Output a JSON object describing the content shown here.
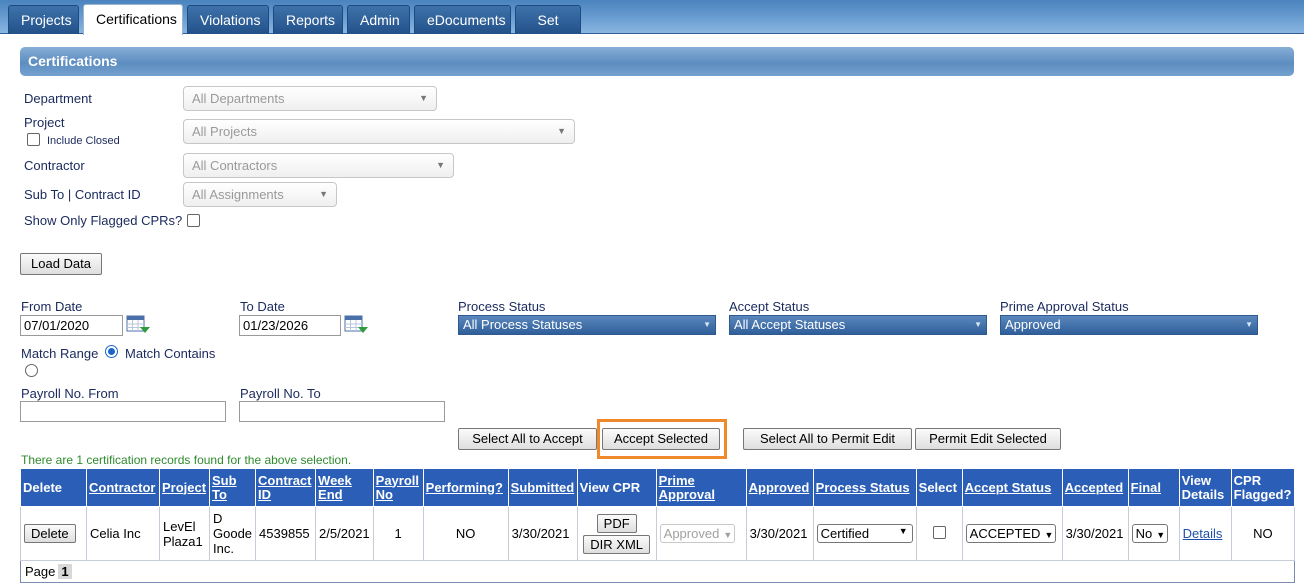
{
  "tabs": [
    "Projects",
    "Certifications",
    "Violations",
    "Reports",
    "Admin",
    "eDocuments",
    "Set Up"
  ],
  "section_title": "Certifications",
  "filters": {
    "department_label": "Department",
    "department_value": "All Departments",
    "project_label": "Project",
    "include_closed_label": "Include Closed",
    "project_value": "All Projects",
    "contractor_label": "Contractor",
    "contractor_value": "All Contractors",
    "subto_label": "Sub To | Contract ID",
    "subto_value": "All Assignments",
    "flagged_label": "Show Only Flagged CPRs?",
    "load_button": "Load Data"
  },
  "dates": {
    "from_label": "From Date",
    "from_value": "07/01/2020",
    "to_label": "To Date",
    "to_value": "01/23/2026",
    "process_status_label": "Process Status",
    "process_status_value": "All Process Statuses",
    "accept_status_label": "Accept Status",
    "accept_status_value": "All Accept Statuses",
    "prime_status_label": "Prime Approval Status",
    "prime_status_value": "Approved",
    "match_range_label": "Match Range",
    "match_contains_label": "Match Contains",
    "payroll_from_label": "Payroll No. From",
    "payroll_to_label": "Payroll No. To"
  },
  "actions": {
    "select_all_accept": "Select All to Accept",
    "accept_selected": "Accept Selected",
    "select_all_permit": "Select All to Permit Edit",
    "permit_edit_selected": "Permit Edit Selected"
  },
  "found_text": "There are 1 certification records found for the above selection.",
  "table": {
    "headers": {
      "delete": "Delete",
      "contractor": "Contractor",
      "project": "Project",
      "sub_to": "Sub To",
      "contract_id": "Contract ID",
      "week_end": "Week End",
      "payroll_no": "Payroll No",
      "performing": "Performing?",
      "submitted": "Submitted",
      "view_cpr": "View CPR",
      "prime_approval": "Prime Approval",
      "approved": "Approved",
      "process_status": "Process Status",
      "select": "Select",
      "accept_status": "Accept Status",
      "accepted": "Accepted",
      "final": "Final",
      "view_details": "View Details",
      "cpr_flagged": "CPR Flagged?"
    },
    "row": {
      "delete_button": "Delete",
      "contractor": "Celia Inc",
      "project": "LevEl Plaza1",
      "sub_to": "D Goode Inc.",
      "contract_id": "4539855",
      "week_end": "2/5/2021",
      "payroll_no": "1",
      "performing": "NO",
      "submitted": "3/30/2021",
      "pdf_button": "PDF",
      "dir_xml_button": "DIR XML",
      "prime_approval": "Approved",
      "approved": "3/30/2021",
      "process_status": "Certified",
      "accept_status": "ACCEPTED",
      "accepted": "3/30/2021",
      "final": "No",
      "details_link": "Details",
      "cpr_flagged": "NO"
    },
    "pager_label": "Page",
    "pager_current": "1"
  },
  "colors": {
    "header_blue": "#2b5fb7",
    "highlight_orange": "#f0892b",
    "found_green": "#2f8a2f"
  }
}
